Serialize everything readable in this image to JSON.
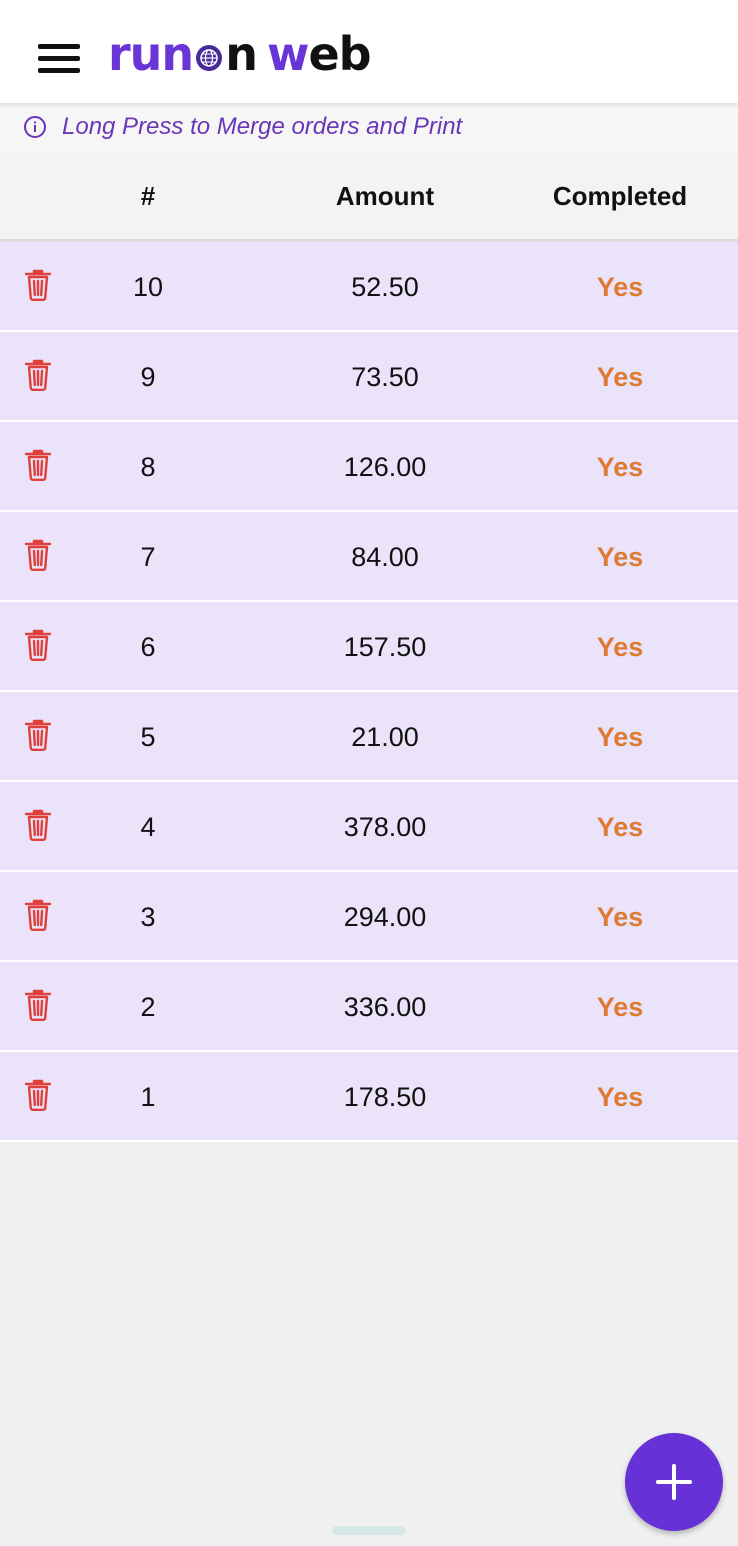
{
  "app_bar": {
    "menu_icon": "hamburger-menu-icon",
    "logo": {
      "part1": "run",
      "part2": "n",
      "part3": "w",
      "part4": "eb",
      "brand_color": "#6a35d6"
    }
  },
  "info_banner": {
    "icon": "info-icon",
    "text": "Long Press to Merge orders and Print"
  },
  "table": {
    "columns": [
      "#",
      "Amount",
      "Completed"
    ],
    "rows": [
      {
        "num": "10",
        "amount": "52.50",
        "completed": "Yes"
      },
      {
        "num": "9",
        "amount": "73.50",
        "completed": "Yes"
      },
      {
        "num": "8",
        "amount": "126.00",
        "completed": "Yes"
      },
      {
        "num": "7",
        "amount": "84.00",
        "completed": "Yes"
      },
      {
        "num": "6",
        "amount": "157.50",
        "completed": "Yes"
      },
      {
        "num": "5",
        "amount": "21.00",
        "completed": "Yes"
      },
      {
        "num": "4",
        "amount": "378.00",
        "completed": "Yes"
      },
      {
        "num": "3",
        "amount": "294.00",
        "completed": "Yes"
      },
      {
        "num": "2",
        "amount": "336.00",
        "completed": "Yes"
      },
      {
        "num": "1",
        "amount": "178.50",
        "completed": "Yes"
      }
    ],
    "row_action_icon": "trash-icon"
  },
  "fab": {
    "icon": "plus-icon",
    "color": "#6632d8"
  },
  "colors": {
    "row_background": "#ebe3fa",
    "completed_text": "#dd7a33",
    "trash": "#e0403a"
  }
}
